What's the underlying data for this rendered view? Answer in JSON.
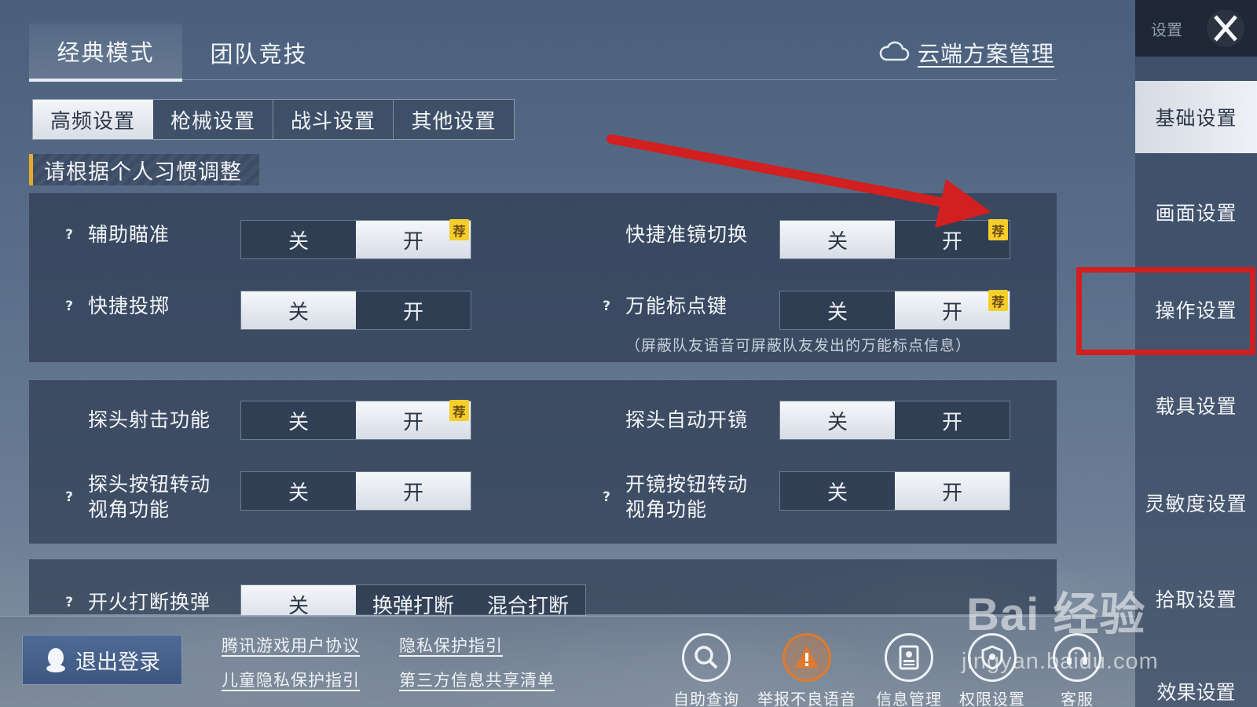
{
  "mode_tabs": [
    {
      "label": "经典模式",
      "active": true
    },
    {
      "label": "团队竞技",
      "active": false
    }
  ],
  "cloud_manage_label": "云端方案管理",
  "sub_tabs": [
    {
      "label": "高频设置",
      "active": true
    },
    {
      "label": "枪械设置",
      "active": false
    },
    {
      "label": "战斗设置",
      "active": false
    },
    {
      "label": "其他设置",
      "active": false
    }
  ],
  "section_title": "请根据个人习惯调整",
  "toggle_options": {
    "off": "关",
    "on": "开"
  },
  "recommend_badge": "荐",
  "help_mark": "?",
  "settings": {
    "aim_assist": {
      "label": "辅助瞄准",
      "value": "开",
      "recommended": "开"
    },
    "quick_scope_switch": {
      "label": "快捷准镜切换",
      "value": "关",
      "recommended": "开"
    },
    "quick_throw": {
      "label": "快捷投掷",
      "value": "关"
    },
    "universal_marker": {
      "label": "万能标点键",
      "value": "开",
      "recommended": "开"
    },
    "universal_marker_note": "（屏蔽队友语音可屏蔽队友发出的万能标点信息）",
    "peek_fire": {
      "label": "探头射击功能",
      "value": "开",
      "recommended": "开"
    },
    "peek_auto_scope": {
      "label": "探头自动开镜",
      "value": "关"
    },
    "peek_button_rotate": {
      "label_line1": "探头按钮转动",
      "label_line2": "视角功能",
      "value": "开"
    },
    "scope_button_rotate": {
      "label_line1": "开镜按钮转动",
      "label_line2": "视角功能",
      "value": "开"
    },
    "fire_interrupt_reload": {
      "label": "开火打断换弹",
      "options": [
        "关",
        "换弹打断",
        "混合打断"
      ],
      "value": "关"
    }
  },
  "sidebar": {
    "header": "设置",
    "items": [
      {
        "label": "基础设置",
        "active": true
      },
      {
        "label": "画面设置",
        "active": false
      },
      {
        "label": "操作设置",
        "active": false
      },
      {
        "label": "载具设置",
        "active": false
      },
      {
        "label": "灵敏度设置",
        "active": false
      },
      {
        "label": "拾取设置",
        "active": false
      },
      {
        "label": "效果设置",
        "active": false
      }
    ]
  },
  "bottom": {
    "logout_label": "退出登录",
    "links": [
      "腾讯游戏用户协议",
      "隐私保护指引",
      "儿童隐私保护指引",
      "第三方信息共享清单"
    ],
    "icons": [
      {
        "label": "自助查询",
        "icon": "search-icon"
      },
      {
        "label": "举报不良语音",
        "icon": "report-voice-icon"
      },
      {
        "label": "信息管理",
        "icon": "info-manage-icon"
      },
      {
        "label": "权限设置",
        "icon": "permission-icon"
      },
      {
        "label": "客服",
        "icon": "support-icon"
      }
    ]
  },
  "watermark": {
    "brand": "Bai 经验",
    "url": "jingyan.baidu.com"
  },
  "colors": {
    "annotation_red": "#d21f1f",
    "badge_yellow": "#f4cf2c",
    "section_accent": "#e8a92a"
  }
}
